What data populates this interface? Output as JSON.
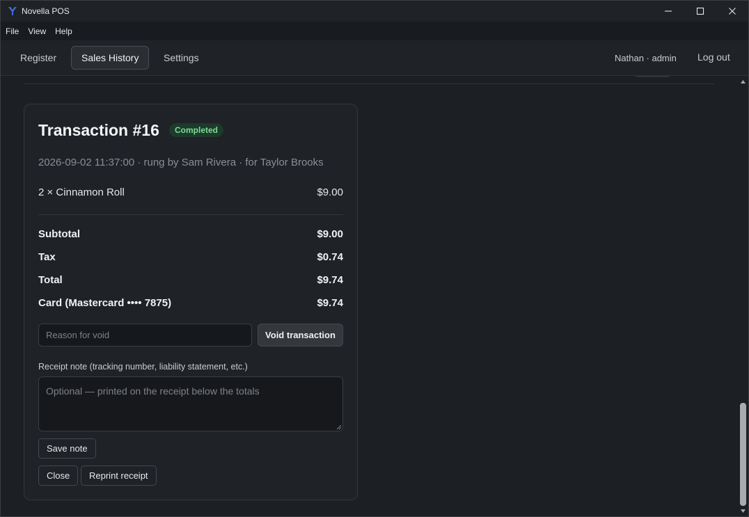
{
  "window": {
    "title": "Novella POS"
  },
  "menu": [
    "File",
    "View",
    "Help"
  ],
  "nav": {
    "tabs": [
      "Register",
      "Sales History",
      "Settings"
    ],
    "active_tab": "Sales History",
    "user": "Nathan · admin",
    "logout": "Log out"
  },
  "transaction": {
    "title": "Transaction #16",
    "status": "Completed",
    "meta": "2026-09-02 11:37:00 · rung by Sam Rivera · for Taylor Brooks",
    "items": [
      {
        "label": "2 × Cinnamon Roll",
        "amount": "$9.00"
      }
    ],
    "totals": [
      {
        "label": "Subtotal",
        "amount": "$9.00"
      },
      {
        "label": "Tax",
        "amount": "$0.74"
      },
      {
        "label": "Total",
        "amount": "$9.74"
      },
      {
        "label": "Card (Mastercard •••• 7875)",
        "amount": "$9.74"
      }
    ],
    "void_placeholder": "Reason for void",
    "void_button": "Void transaction",
    "note_label": "Receipt note (tracking number, liability statement, etc.)",
    "note_placeholder": "Optional — printed on the receipt below the totals",
    "save_note": "Save note",
    "close": "Close",
    "reprint": "Reprint receipt"
  },
  "colors": {
    "background": "#1c1f24",
    "badge_bg": "#1d3a2a",
    "badge_text": "#7ddb97",
    "logo": "#3b6fd8"
  },
  "icons": [
    "app-logo-icon",
    "minimize-icon",
    "maximize-icon",
    "close-icon",
    "scroll-up-icon",
    "scroll-down-icon",
    "resize-grip-icon"
  ]
}
